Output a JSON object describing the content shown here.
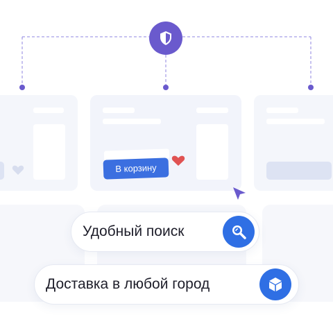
{
  "product_card": {
    "cart_button_label": "В корзину"
  },
  "features": [
    {
      "label": "Удобный поиск",
      "icon": "search-icon"
    },
    {
      "label": "Доставка в любой город",
      "icon": "box-icon"
    }
  ],
  "colors": {
    "accent_purple": "#6a5acd",
    "primary_blue": "#2f6fe4",
    "heart_red": "#e05252",
    "card_bg": "#f2f4fb"
  },
  "icons": {
    "badge": "shield-icon",
    "cursor": "pointer-cursor-icon",
    "favorite": "heart-icon"
  }
}
